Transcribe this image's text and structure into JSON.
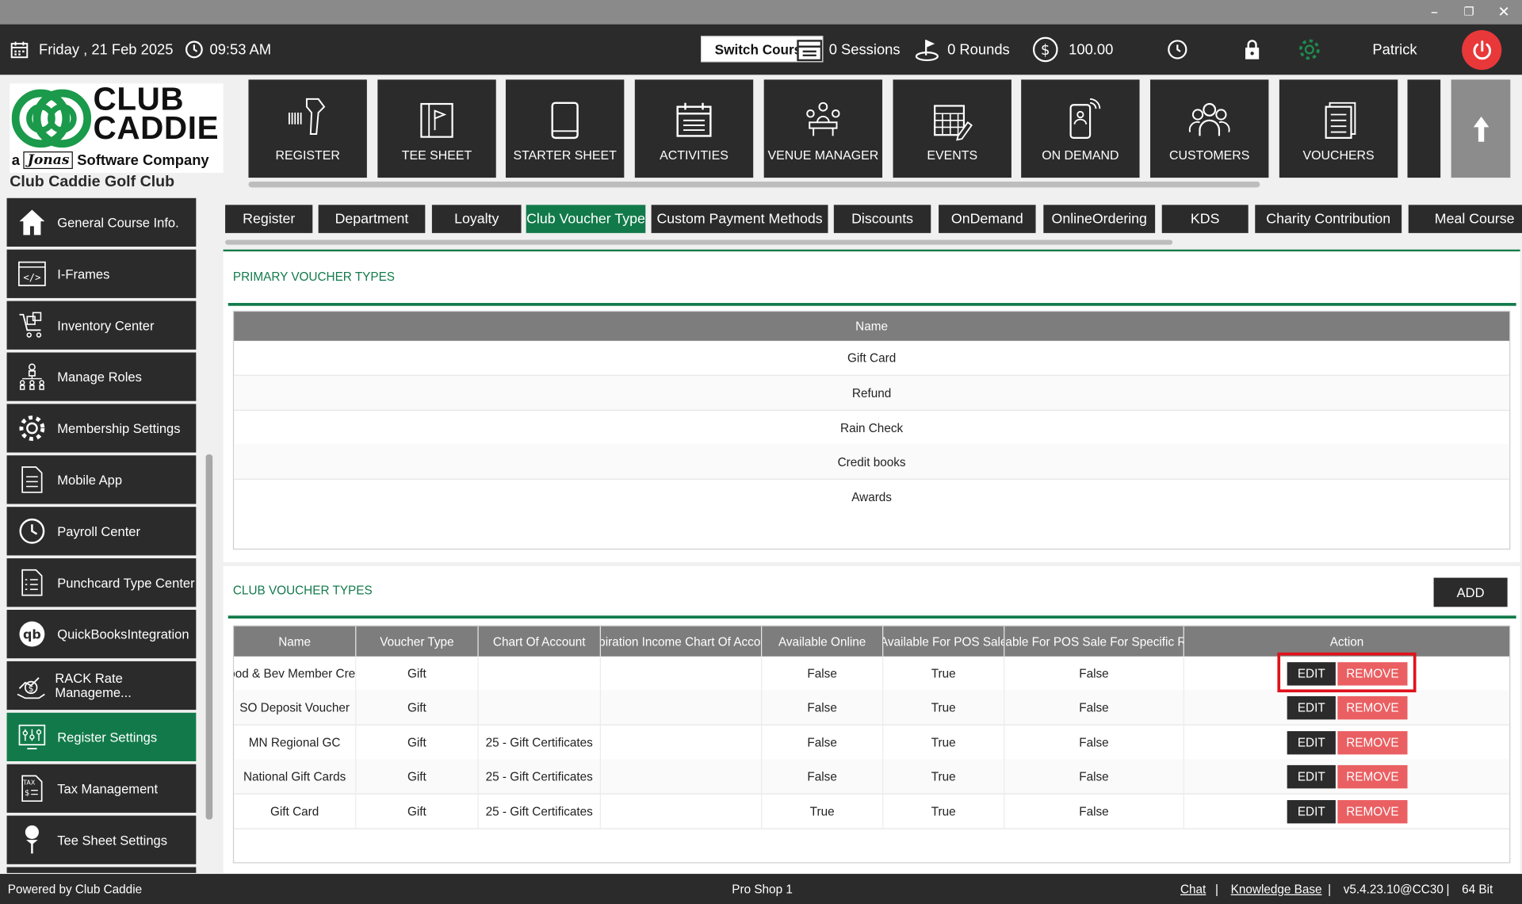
{
  "window": {
    "minimize_icon": "minimize-icon",
    "restore_icon": "restore-icon",
    "close_icon": "close-icon"
  },
  "topbar": {
    "date": "Friday ,  21 Feb 2025",
    "time": "09:53 AM",
    "switch_course_label": "Switch Course",
    "sessions": "0 Sessions",
    "rounds": "0 Rounds",
    "balance": "100.00",
    "user": "Patrick"
  },
  "logo": {
    "line1": "CLUB",
    "line2": "CADDIE",
    "tagline_a": "a",
    "tagline_brand": "Jonas",
    "tagline_rest": "Software Company"
  },
  "club_name": "Club Caddie Golf Club",
  "nav_tiles": [
    "REGISTER",
    "TEE SHEET",
    "STARTER SHEET",
    "ACTIVITIES",
    "VENUE MANAGER",
    "EVENTS",
    "ON DEMAND",
    "CUSTOMERS",
    "VOUCHERS"
  ],
  "sidebar": {
    "items": [
      {
        "label": "General Course Info.",
        "icon": "home-icon"
      },
      {
        "label": "I-Frames",
        "icon": "code-icon"
      },
      {
        "label": "Inventory Center",
        "icon": "inventory-icon"
      },
      {
        "label": "Manage Roles",
        "icon": "roles-icon"
      },
      {
        "label": "Membership Settings",
        "icon": "gear-icon"
      },
      {
        "label": "Mobile App",
        "icon": "document-icon"
      },
      {
        "label": "Payroll Center",
        "icon": "clock-icon"
      },
      {
        "label": "Punchcard Type Center",
        "icon": "checklist-icon"
      },
      {
        "label": "QuickBooksIntegration",
        "icon": "quickbooks-icon"
      },
      {
        "label": "RACK Rate Manageme...",
        "icon": "rate-icon"
      },
      {
        "label": "Register Settings",
        "icon": "register-settings-icon"
      },
      {
        "label": "Tax Management",
        "icon": "tax-icon"
      },
      {
        "label": "Tee Sheet Settings",
        "icon": "tee-icon"
      }
    ]
  },
  "tabs": [
    "Register",
    "Department",
    "Loyalty",
    "Club Voucher Type",
    "Custom Payment Methods",
    "Discounts",
    "OnDemand",
    "OnlineOrdering",
    "KDS",
    "Charity Contribution",
    "Meal Course"
  ],
  "active_tab": "Club Voucher Type",
  "primary": {
    "title": "PRIMARY VOUCHER TYPES",
    "header": "Name",
    "rows": [
      "Gift Card",
      "Refund",
      "Rain Check",
      "Credit books",
      "Awards"
    ]
  },
  "club": {
    "title": "CLUB VOUCHER TYPES",
    "add_label": "ADD",
    "columns": [
      "Name",
      "Voucher Type",
      "Chart Of Account",
      "Expiration Income Chart Of Account",
      "Available Online",
      "Available For POS Sale",
      "Available For POS Sale For Specific Roles",
      "Action"
    ],
    "edit_label": "EDIT",
    "remove_label": "REMOVE",
    "rows": [
      [
        "Food & Bev Member Credit",
        "Gift",
        "",
        "",
        "False",
        "True",
        "False"
      ],
      [
        "SO Deposit Voucher",
        "Gift",
        "",
        "",
        "False",
        "True",
        "False"
      ],
      [
        "MN Regional GC",
        "Gift",
        "25 - Gift Certificates",
        "",
        "False",
        "True",
        "False"
      ],
      [
        "National Gift Cards",
        "Gift",
        "25 - Gift Certificates",
        "",
        "False",
        "True",
        "False"
      ],
      [
        "Gift Card",
        "Gift",
        "25 - Gift Certificates",
        "",
        "True",
        "True",
        "False"
      ]
    ]
  },
  "footer": {
    "powered": "Powered by Club Caddie",
    "station": "Pro Shop 1",
    "chat": "Chat",
    "kb": "Knowledge Base",
    "version": "v5.4.23.10@CC30",
    "bits": "64 Bit",
    "sep": "|"
  },
  "colors": {
    "accent": "#127a4a",
    "dark": "#2b2b2b",
    "danger": "#ea5f62",
    "highlight": "#e0121c"
  }
}
